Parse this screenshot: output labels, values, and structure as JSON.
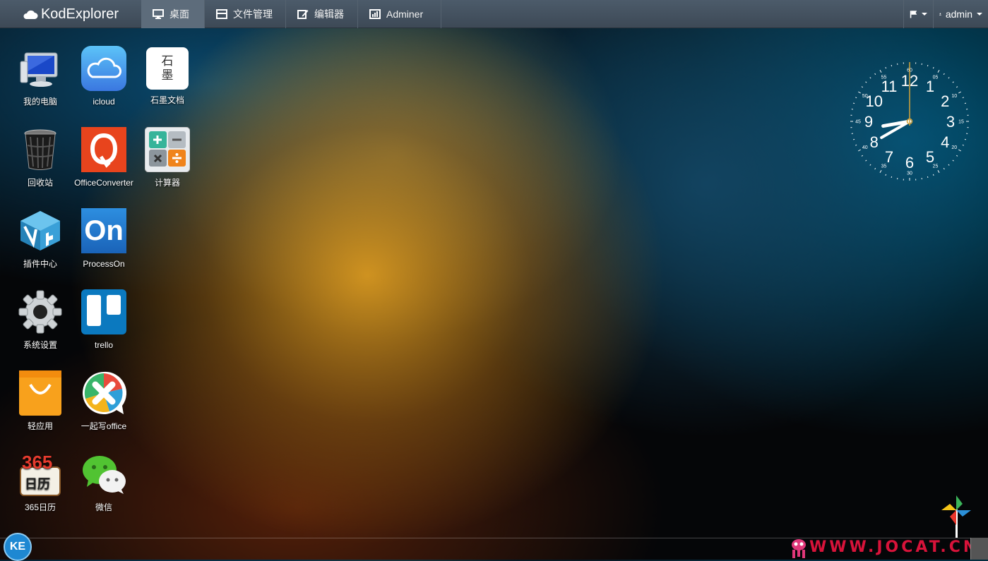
{
  "app": {
    "brand": "KodExplorer"
  },
  "nav": {
    "tabs": [
      {
        "label": "桌面",
        "icon": "desktop-icon",
        "active": true
      },
      {
        "label": "文件管理",
        "icon": "file-manager-icon",
        "active": false
      },
      {
        "label": "编辑器",
        "icon": "edit-icon",
        "active": false
      },
      {
        "label": "Adminer",
        "icon": "chart-icon",
        "active": false
      }
    ]
  },
  "header_right": {
    "user": "admin"
  },
  "desktop": {
    "icons": [
      {
        "label": "我的电脑",
        "icon": "computer-icon"
      },
      {
        "label": "icloud",
        "icon": "icloud-icon"
      },
      {
        "label": "石墨文档",
        "icon": "shimo-icon"
      },
      {
        "label": "回收站",
        "icon": "recycle-bin-icon"
      },
      {
        "label": "OfficeConverter",
        "icon": "office-converter-icon"
      },
      {
        "label": "计算器",
        "icon": "calculator-icon"
      },
      {
        "label": "插件中心",
        "icon": "plugin-center-icon"
      },
      {
        "label": "ProcessOn",
        "icon": "processon-icon"
      },
      {
        "label": "系统设置",
        "icon": "settings-gear-icon"
      },
      {
        "label": "trello",
        "icon": "trello-icon"
      },
      {
        "label": "轻应用",
        "icon": "light-app-bag-icon"
      },
      {
        "label": "一起写office",
        "icon": "yiqixie-icon"
      },
      {
        "label": "365日历",
        "icon": "calendar-365-icon"
      },
      {
        "label": "微信",
        "icon": "wechat-icon"
      }
    ],
    "shimo_glyphs": "石\n墨",
    "processon_glyph": "On",
    "calendar_text": "日历",
    "calendar_number": "365"
  },
  "clock": {
    "hour_numbers": [
      "12",
      "1",
      "2",
      "3",
      "4",
      "5",
      "6",
      "7",
      "8",
      "9",
      "10",
      "11"
    ],
    "minute_numbers": [
      "60",
      "05",
      "10",
      "15",
      "20",
      "25",
      "30",
      "35",
      "40",
      "45",
      "50",
      "55"
    ],
    "time": {
      "hour": 8,
      "minute": 40,
      "second": 0
    }
  },
  "taskbar": {
    "start_label": "KE",
    "watermark": "WWW.JOCAT.CN"
  },
  "colors": {
    "topbar": "#45525f",
    "active_tab": "#5d6c7b",
    "ke_button": "#1e88d2",
    "watermark": "#d8133a"
  }
}
